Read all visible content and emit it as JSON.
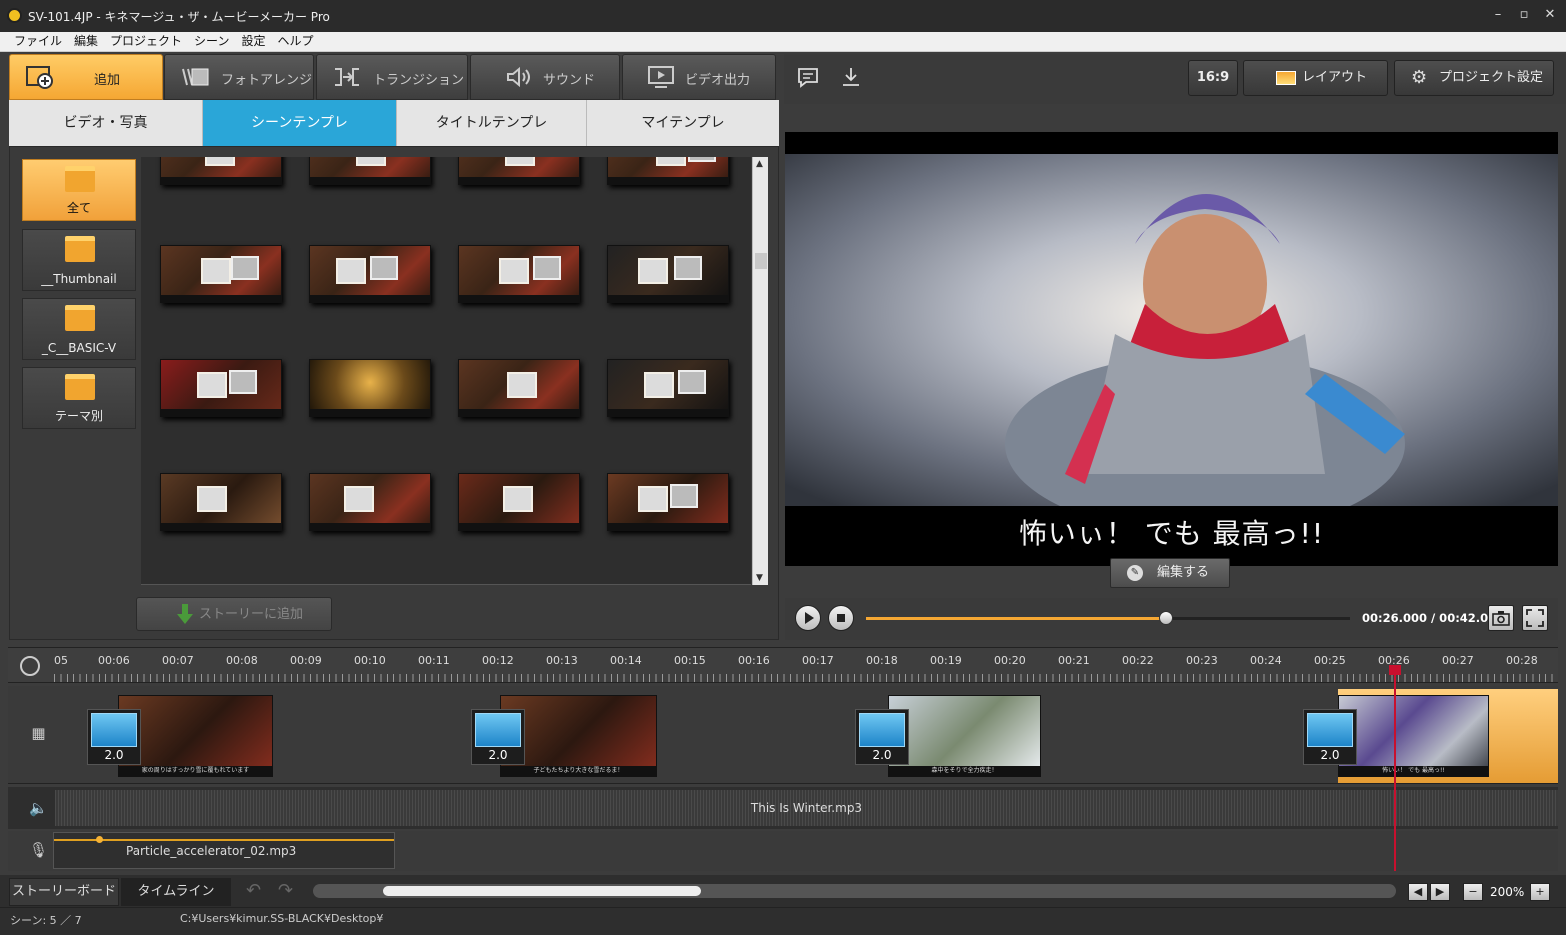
{
  "window": {
    "title": "SV-101.4JP - キネマージュ・ザ・ムービーメーカー Pro",
    "min": "–",
    "max": "▫",
    "close": "✕"
  },
  "menu": [
    "ファイル",
    "編集",
    "プロジェクト",
    "シーン",
    "設定",
    "ヘルプ"
  ],
  "main_tabs": [
    {
      "label": "追加",
      "icon": "add-icon"
    },
    {
      "label": "フォトアレンジ",
      "icon": "photo-arrange-icon"
    },
    {
      "label": "トランジション",
      "icon": "transition-icon"
    },
    {
      "label": "サウンド",
      "icon": "sound-icon"
    },
    {
      "label": "ビデオ出力",
      "icon": "video-output-icon"
    }
  ],
  "sub_tabs": [
    "ビデオ・写真",
    "シーンテンプレ",
    "タイトルテンプレ",
    "マイテンプレ"
  ],
  "folders": [
    "全て",
    "__Thumbnail",
    "_C__BASIC-V",
    "テーマ別"
  ],
  "add_story_button": "ストーリーに追加",
  "toolbar": {
    "aspect": "16:9",
    "layout": "レイアウト",
    "project_settings": "プロジェクト設定"
  },
  "preview": {
    "caption": "怖いぃ！ でも 最高っ!!",
    "edit_button": "編集する"
  },
  "player": {
    "timecode": "00:26.000 / 00:42.000",
    "progress": 0.62
  },
  "ruler": [
    "05",
    "00:06",
    "00:07",
    "00:08",
    "00:09",
    "00:10",
    "00:11",
    "00:12",
    "00:13",
    "00:14",
    "00:15",
    "00:16",
    "00:17",
    "00:18",
    "00:19",
    "00:20",
    "00:21",
    "00:22",
    "00:23",
    "00:24",
    "00:25",
    "00:26",
    "00:27",
    "00:28"
  ],
  "transitions": [
    "2.0",
    "2.0",
    "2.0",
    "2.0"
  ],
  "clip_captions": [
    "家の周りはすっかり雪に覆もれています",
    "子どもたちより大きな雪だるま！",
    "森中をそりで全力疾走！",
    "怖いぃ！ でも 最高っ!!"
  ],
  "audio_track": "This Is Winter.mp3",
  "narration_track": "Particle_accelerator_02.mp3",
  "bottom_tabs": [
    "ストーリーボード",
    "タイムライン"
  ],
  "zoom": "200%",
  "status": {
    "scene": "シーン:   5 ／ 7",
    "path": "C:¥Users¥kimur.SS-BLACK¥Desktop¥"
  }
}
